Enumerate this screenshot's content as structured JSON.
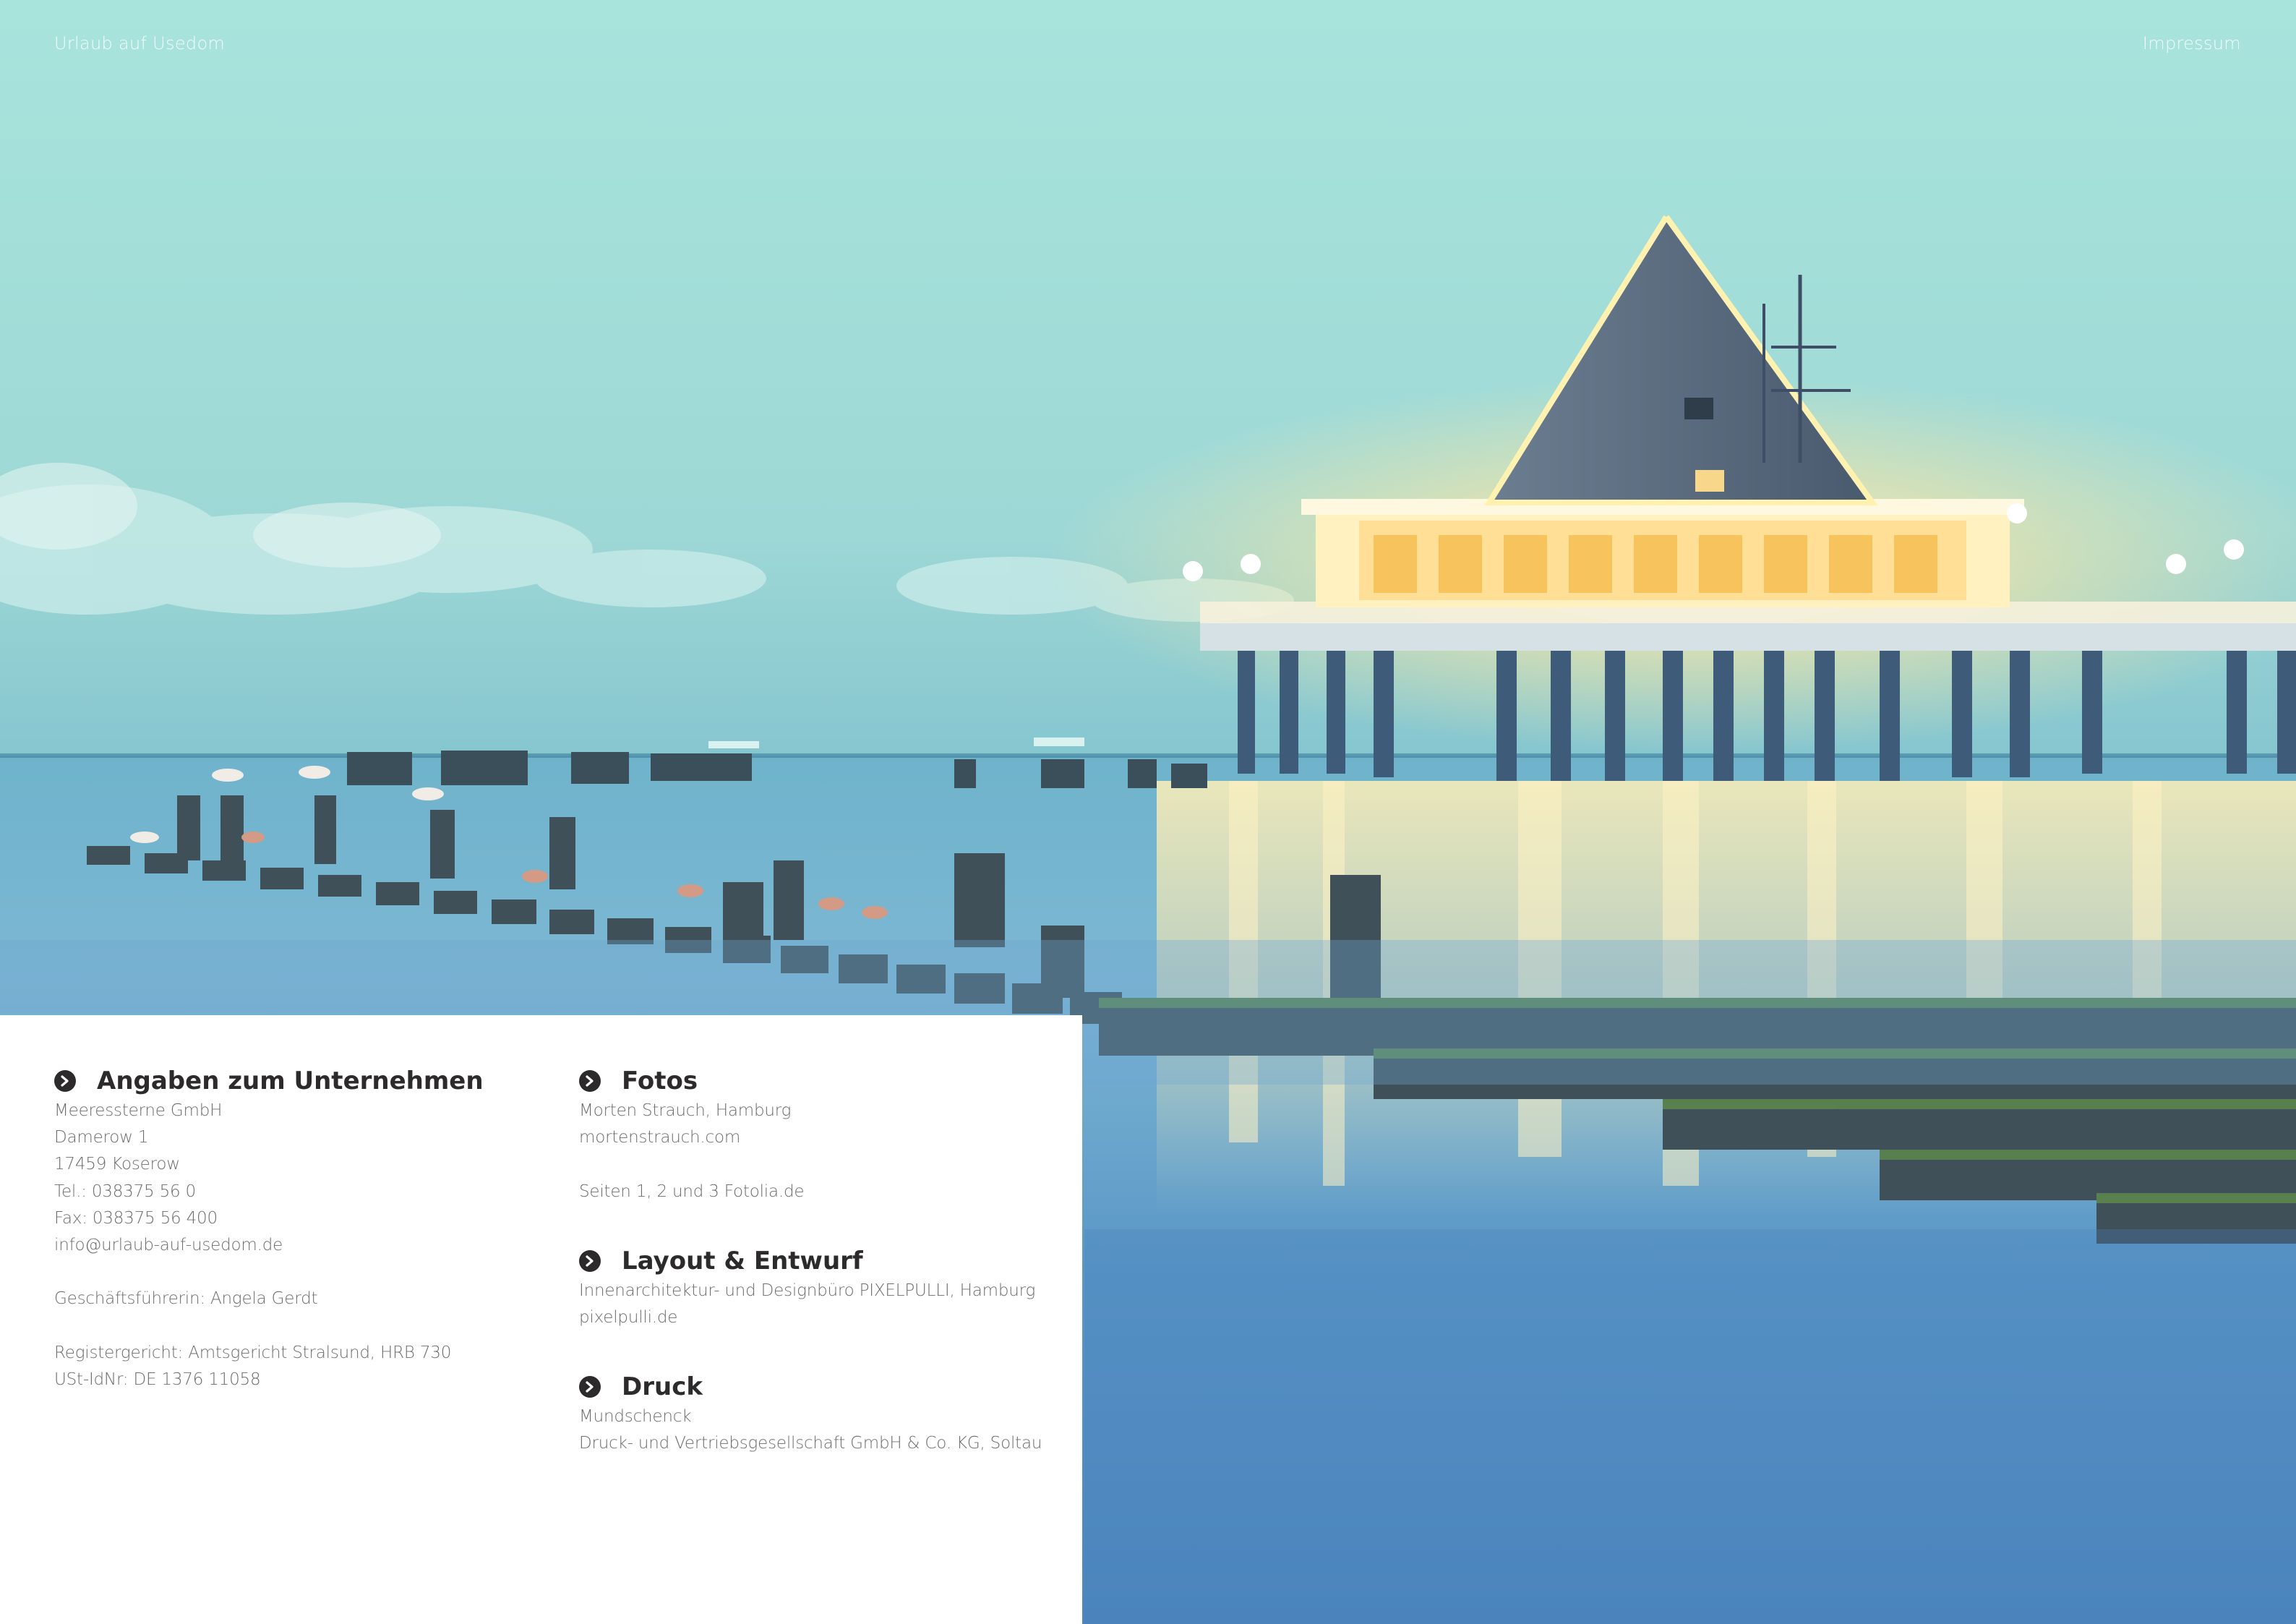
{
  "header": {
    "left": "Urlaub auf Usedom",
    "right": "Impressum"
  },
  "colors": {
    "sky_top": "#a6e3dc",
    "sky_horizon": "#87c8cf",
    "sea": "#4f93c0",
    "pier_glow": "#ffe7a1",
    "heading_text": "#2d2a2b",
    "body_text": "#6f6b6c"
  },
  "photo": {
    "icons": [
      "sea-pier-photo",
      "groyne-posts",
      "seagulls"
    ]
  },
  "sections_left": [
    {
      "heading": "Angaben zum Unternehmen",
      "icon": "chevron-right-circle-icon",
      "lines": [
        "Meeressterne GmbH",
        "Damerow 1",
        "17459 Koserow",
        "Tel.: 038375 56 0",
        "Fax: 038375 56 400",
        "info@urlaub-auf-usedom.de",
        "",
        "Geschäftsführerin: Angela Gerdt",
        "",
        "Registergericht: Amtsgericht Stralsund, HRB 730",
        "USt-IdNr: DE 1376 11058"
      ]
    }
  ],
  "sections_right": [
    {
      "heading": "Fotos",
      "icon": "chevron-right-circle-icon",
      "lines": [
        "Morten Strauch, Hamburg",
        "mortenstrauch.com",
        "",
        "Seiten 1, 2 und 3 Fotolia.de"
      ]
    },
    {
      "heading": "Layout & Entwurf",
      "icon": "chevron-right-circle-icon",
      "lines": [
        "Innenarchitektur- und Designbüro PIXELPULLI, Hamburg",
        "pixelpulli.de"
      ]
    },
    {
      "heading": "Druck",
      "icon": "chevron-right-circle-icon",
      "lines": [
        "Mundschenck",
        "Druck- und Vertriebsgesellschaft GmbH & Co. KG, Soltau"
      ]
    }
  ]
}
